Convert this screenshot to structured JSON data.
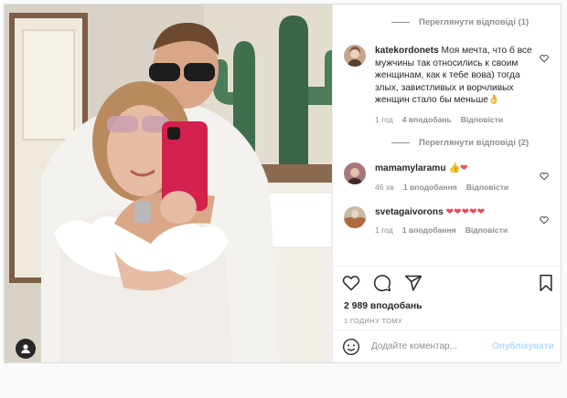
{
  "post": {
    "icons": {
      "user_tag": "user-tag-icon",
      "like": "heart-icon",
      "comment": "comment-bubble-icon",
      "share": "share-paper-plane-icon",
      "save": "bookmark-icon",
      "emoji": "emoji-smile-icon"
    }
  },
  "comments": {
    "view_replies_1": "Переглянути відповіді (1)",
    "view_replies_2": "Переглянути відповіді (2)",
    "items": [
      {
        "username": "katekordonets",
        "text": "Моя мечта, что б все мужчины так относились к своим женщинам, как к тебе вова) тогда злых, завистливых и ворчливых женщин стало бы меньше👌",
        "time": "1 год",
        "likes": "4 вподобань",
        "reply": "Відповісти"
      },
      {
        "username": "mamamylaramu",
        "text": "👍❤",
        "time": "46 хв",
        "likes": "1 вподобання",
        "reply": "Відповісти"
      },
      {
        "username": "svetagaivorons",
        "text": "❤❤❤❤❤",
        "time": "1 год",
        "likes": "1 вподобання",
        "reply": "Відповісти"
      }
    ]
  },
  "likes_count": "2 989 вподобань",
  "posted_ago": "1 ГОДИНУ ТОМУ",
  "add_comment": {
    "placeholder": "Додайте коментар...",
    "publish_label": "Опублікувати"
  },
  "colors": {
    "heart": "#ed4956",
    "publish_disabled": "#b3dbff",
    "secondary_text": "#8e8e8e"
  }
}
